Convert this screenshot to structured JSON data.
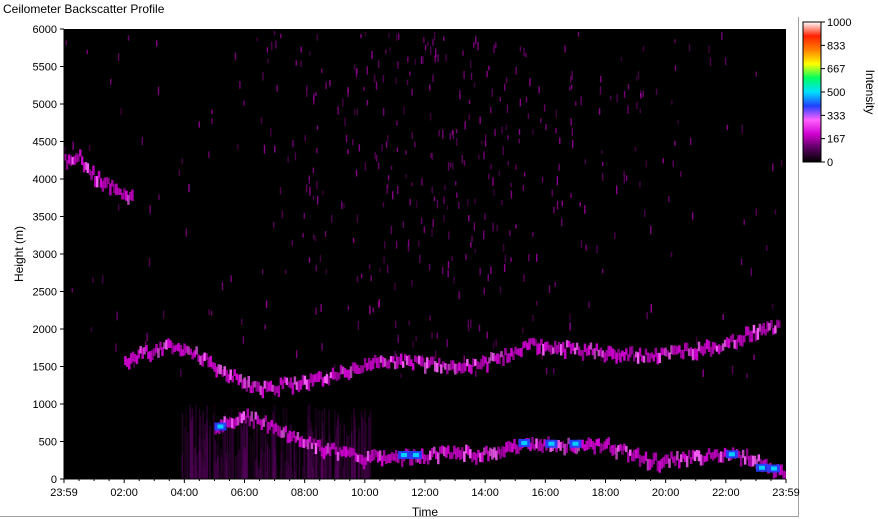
{
  "window": {
    "title": "Ceilometer Backscatter Profile"
  },
  "colors": {
    "plot_background": "#000000",
    "axis": "#000000",
    "colormap": [
      "#000000",
      "#5a0060",
      "#d000d0",
      "#ff60ff",
      "#2040ff",
      "#00e0ff",
      "#00ff60",
      "#ffff00",
      "#ff8000",
      "#ff2000",
      "#ffffff"
    ]
  },
  "chart_data": {
    "type": "heatmap",
    "title": "Ceilometer Backscatter Profile",
    "xlabel": "Time",
    "ylabel": "Height (m)",
    "x_tick_labels": [
      "23:59",
      "02:00",
      "04:00",
      "06:00",
      "08:00",
      "10:00",
      "12:00",
      "14:00",
      "16:00",
      "18:00",
      "20:00",
      "22:00",
      "23:59"
    ],
    "x_ticks_hours": [
      0,
      2,
      4,
      6,
      8,
      10,
      12,
      14,
      16,
      18,
      20,
      22,
      24
    ],
    "xlim_hours": [
      0,
      24
    ],
    "y_ticks": [
      0,
      500,
      1000,
      1500,
      2000,
      2500,
      3000,
      3500,
      4000,
      4500,
      5000,
      5500,
      6000
    ],
    "ylim": [
      0,
      6000
    ],
    "colorbar": {
      "label": "Intensity",
      "ticks": [
        0,
        167,
        333,
        500,
        667,
        833,
        1000
      ],
      "tick_labels": [
        "0",
        "167",
        "333",
        "500",
        "667",
        "833",
        "1000"
      ],
      "range": [
        0,
        1000
      ]
    },
    "layers": [
      {
        "name_shown": false,
        "description_key": "boundary_layer_low",
        "points": [
          [
            5.0,
            700
          ],
          [
            5.3,
            760
          ],
          [
            6.0,
            850
          ],
          [
            7.0,
            700
          ],
          [
            8.0,
            500
          ],
          [
            9.0,
            380
          ],
          [
            10.0,
            300
          ],
          [
            11.0,
            320
          ],
          [
            12.0,
            330
          ],
          [
            13.0,
            380
          ],
          [
            14.0,
            350
          ],
          [
            15.0,
            450
          ],
          [
            16.0,
            480
          ],
          [
            17.0,
            470
          ],
          [
            18.0,
            480
          ],
          [
            19.5,
            250
          ],
          [
            21.0,
            300
          ],
          [
            22.0,
            350
          ],
          [
            22.8,
            300
          ],
          [
            23.5,
            150
          ],
          [
            24.0,
            120
          ]
        ]
      },
      {
        "name_shown": false,
        "description_key": "upper_layer",
        "points": [
          [
            0.0,
            4250
          ],
          [
            0.5,
            4300
          ],
          [
            1.0,
            4050
          ],
          [
            1.5,
            3900
          ],
          [
            2.3,
            3750
          ]
        ]
      },
      {
        "name_shown": false,
        "description_key": "mid_layer",
        "points": [
          [
            2.0,
            1600
          ],
          [
            2.7,
            1700
          ],
          [
            3.5,
            1800
          ],
          [
            4.5,
            1650
          ],
          [
            5.5,
            1400
          ],
          [
            6.5,
            1200
          ],
          [
            9.5,
            1450
          ],
          [
            10.5,
            1600
          ],
          [
            13.5,
            1500
          ],
          [
            14.5,
            1650
          ],
          [
            15.5,
            1800
          ],
          [
            18.0,
            1700
          ],
          [
            19.5,
            1650
          ],
          [
            21.0,
            1750
          ],
          [
            22.0,
            1800
          ],
          [
            22.7,
            1950
          ],
          [
            23.8,
            2050
          ]
        ]
      }
    ]
  }
}
